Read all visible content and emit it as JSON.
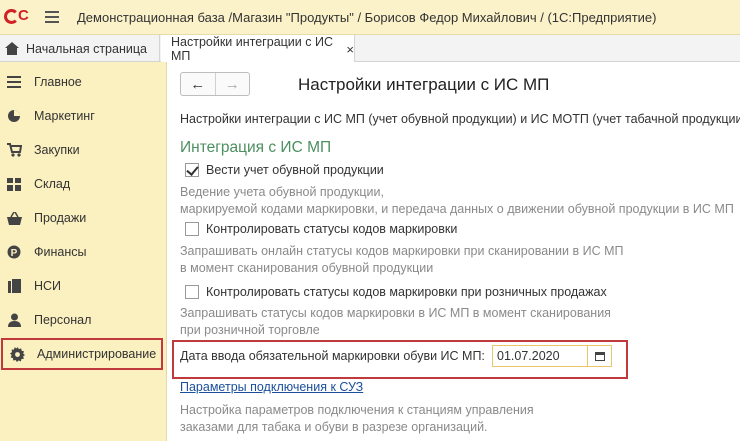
{
  "window": {
    "title": "Демонстрационная база /Магазин \"Продукты\" / Борисов Федор Михайлович /  (1С:Предприятие)"
  },
  "tabs": {
    "home_label": "Начальная страница",
    "active_label": "Настройки интеграции с ИС МП",
    "close_glyph": "×"
  },
  "sidebar": {
    "items": [
      {
        "label": "Главное",
        "icon": "menu-lines-icon"
      },
      {
        "label": "Маркетинг",
        "icon": "pie-chart-icon"
      },
      {
        "label": "Закупки",
        "icon": "cart-icon"
      },
      {
        "label": "Склад",
        "icon": "warehouse-icon"
      },
      {
        "label": "Продажи",
        "icon": "basket-icon"
      },
      {
        "label": "Финансы",
        "icon": "coin-icon"
      },
      {
        "label": "НСИ",
        "icon": "book-icon"
      },
      {
        "label": "Персонал",
        "icon": "person-icon"
      },
      {
        "label": "Администрирование",
        "icon": "gear-icon",
        "active": true
      }
    ]
  },
  "main": {
    "nav_back": "←",
    "nav_forward": "→",
    "page_title": "Настройки интеграции с ИС МП",
    "description": "Настройки интеграции с ИС МП (учет обувной продукции) и ИС МОТП (учет табачной продукции)",
    "section_title": "Интеграция с ИС МП",
    "options": [
      {
        "label": "Вести учет обувной продукции",
        "checked": true,
        "hint": [
          "Ведение учета обувной продукции,",
          "маркируемой кодами маркировки, и передача данных о движении обувной продукции в ИС МП"
        ]
      },
      {
        "label": "Контролировать статусы кодов маркировки",
        "checked": false,
        "hint": [
          "Запрашивать онлайн статусы кодов маркировки при сканировании в ИС МП",
          "в момент сканирования обувной продукции"
        ]
      },
      {
        "label": "Контролировать статусы кодов маркировки при розничных продажах",
        "checked": false,
        "hint": [
          "Запрашивать статусы кодов маркировки в ИС МП в момент сканирования",
          "при розничной торговле"
        ]
      }
    ],
    "date_field": {
      "label": "Дата ввода обязательной маркировки обуви ИС МП:",
      "value": "01.07.2020"
    },
    "link": {
      "label": "Параметры подключения к СУЗ",
      "hint": [
        "Настройка параметров подключения к станциям управления",
        "заказами для табака и обуви в разрезе организаций."
      ]
    }
  },
  "colors": {
    "sidebar_bg": "#fbf0c0",
    "highlight": "#c0393b",
    "section_title": "#4c8f60",
    "link": "#1b4f9c"
  }
}
